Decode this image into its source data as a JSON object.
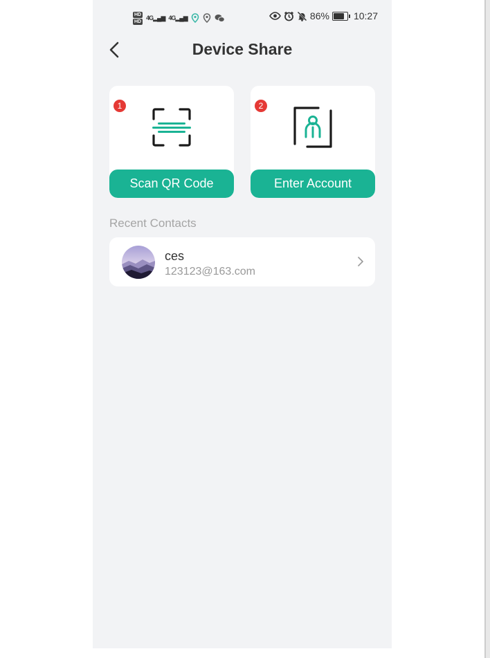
{
  "status_bar": {
    "hd_top": "HD",
    "hd_bottom": "HD",
    "signal_1": "4G",
    "signal_2": "4G",
    "battery_percent": "86%",
    "time": "10:27"
  },
  "header": {
    "title": "Device Share"
  },
  "options": [
    {
      "badge": "1",
      "label": "Scan QR Code",
      "icon": "qr-scan-icon"
    },
    {
      "badge": "2",
      "label": "Enter Account",
      "icon": "account-icon"
    }
  ],
  "recent": {
    "section_title": "Recent Contacts",
    "contacts": [
      {
        "name": "ces",
        "email": "123123@163.com"
      }
    ]
  },
  "colors": {
    "accent": "#1ab394",
    "badge": "#e53935",
    "background": "#f2f3f5"
  }
}
